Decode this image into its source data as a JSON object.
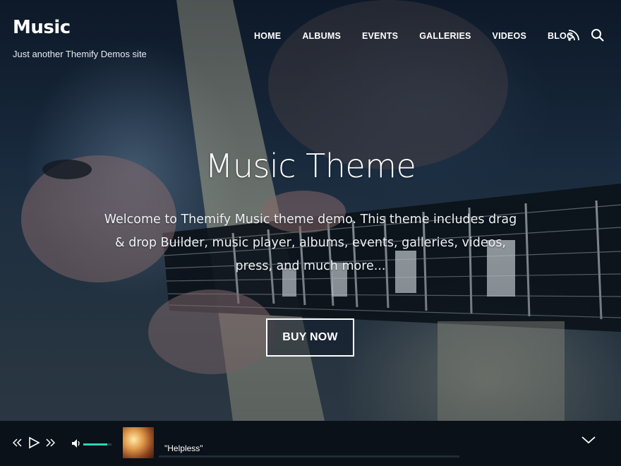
{
  "header": {
    "site_title": "Music",
    "tagline": "Just another Themify Demos site",
    "nav": [
      "HOME",
      "ALBUMS",
      "EVENTS",
      "GALLERIES",
      "VIDEOS",
      "BLOG"
    ],
    "icons": [
      "rss-icon",
      "search-icon"
    ]
  },
  "hero": {
    "title": "Music Theme",
    "text": "Welcome to Themify Music theme demo. This theme includes drag & drop Builder, music player, albums, events, galleries, videos, press, and much more...",
    "button_label": "BUY NOW"
  },
  "player": {
    "track_title": "\"Helpless\"",
    "volume_level": 0.85,
    "progress": 0.0,
    "icons": [
      "previous-icon",
      "play-icon",
      "next-icon",
      "volume-icon",
      "chevron-down-icon"
    ],
    "accent_color": "#2bd6b4"
  }
}
